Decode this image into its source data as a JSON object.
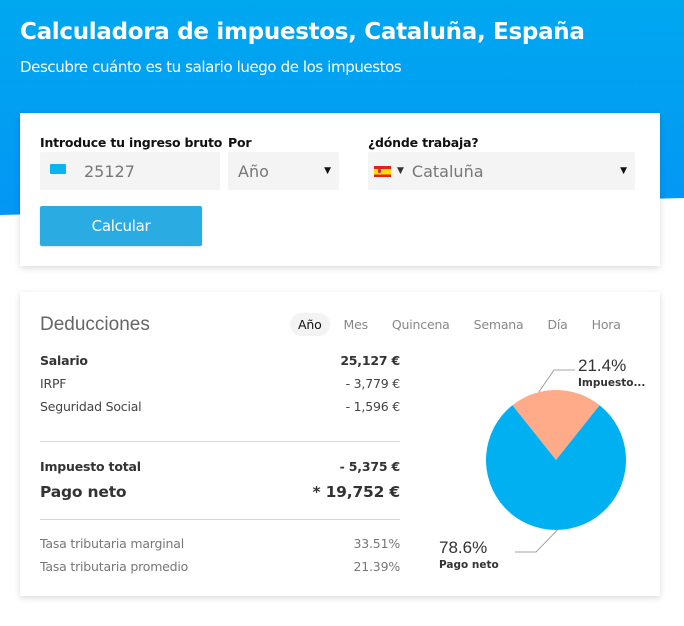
{
  "header": {
    "title": "Calculadora de impuestos, Cataluña, España",
    "subtitle": "Descubre cuánto es tu salario luego de los impuestos"
  },
  "form": {
    "income_label": "Introduce tu ingreso bruto",
    "income_value": "25127",
    "income_icon": "money-icon",
    "period_label": "Por",
    "period_value": "Año",
    "region_label": "¿dónde trabaja?",
    "region_flag": "spain-flag-icon",
    "region_value": "Cataluña",
    "calculate_label": "Calcular"
  },
  "results": {
    "title": "Deducciones",
    "tabs": [
      {
        "label": "Año",
        "active": true
      },
      {
        "label": "Mes",
        "active": false
      },
      {
        "label": "Quincena",
        "active": false
      },
      {
        "label": "Semana",
        "active": false
      },
      {
        "label": "Día",
        "active": false
      },
      {
        "label": "Hora",
        "active": false
      }
    ],
    "salary": {
      "label": "Salario",
      "value": "25,127 €"
    },
    "irpf": {
      "label": "IRPF",
      "value": "- 3,779 €"
    },
    "social_security": {
      "label": "Seguridad Social",
      "value": "- 1,596 €"
    },
    "total_tax": {
      "label": "Impuesto total",
      "value": "- 5,375 €"
    },
    "net_pay": {
      "label": "Pago neto",
      "value": "* 19,752 €"
    },
    "marginal_rate": {
      "label": "Tasa tributaria marginal",
      "value": "33.51%"
    },
    "average_rate": {
      "label": "Tasa tributaria promedio",
      "value": "21.39%"
    }
  },
  "chart_data": {
    "type": "pie",
    "slices": [
      {
        "name": "Impuesto total",
        "display_name": "Impuesto...",
        "value": 21.4,
        "label": "21.4%",
        "color": "#ffab8a"
      },
      {
        "name": "Pago neto",
        "display_name": "Pago neto",
        "value": 78.6,
        "label": "78.6%",
        "color": "#00b0f0"
      }
    ]
  }
}
